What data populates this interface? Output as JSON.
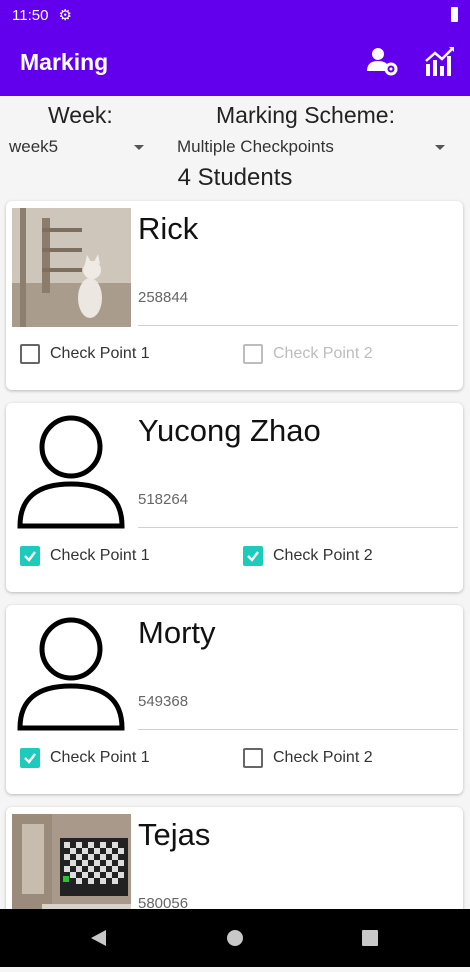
{
  "status_bar": {
    "time": "11:50"
  },
  "app_bar": {
    "title": "Marking",
    "actions": [
      "manage-users-icon",
      "statistics-icon"
    ]
  },
  "week": {
    "label": "Week:",
    "value": "week5"
  },
  "scheme": {
    "label": "Marking Scheme:",
    "value": "Multiple Checkpoints"
  },
  "student_count": "4 Students",
  "checkpoint_labels": [
    "Check Point 1",
    "Check Point 2"
  ],
  "students": [
    {
      "name": "Rick",
      "id": "258844",
      "photo": "cat-photo",
      "cp1": {
        "checked": false,
        "enabled": true
      },
      "cp2": {
        "checked": false,
        "enabled": false
      }
    },
    {
      "name": "Yucong Zhao",
      "id": "518264",
      "photo": "person-outline-icon",
      "cp1": {
        "checked": true,
        "enabled": true
      },
      "cp2": {
        "checked": true,
        "enabled": true
      }
    },
    {
      "name": "Morty",
      "id": "549368",
      "photo": "person-outline-icon",
      "cp1": {
        "checked": true,
        "enabled": true
      },
      "cp2": {
        "checked": false,
        "enabled": true
      }
    },
    {
      "name": "Tejas",
      "id": "580056",
      "photo": "room-with-tv-photo"
    }
  ],
  "colors": {
    "primary": "#6200ee",
    "accent": "#1ccbbb"
  }
}
